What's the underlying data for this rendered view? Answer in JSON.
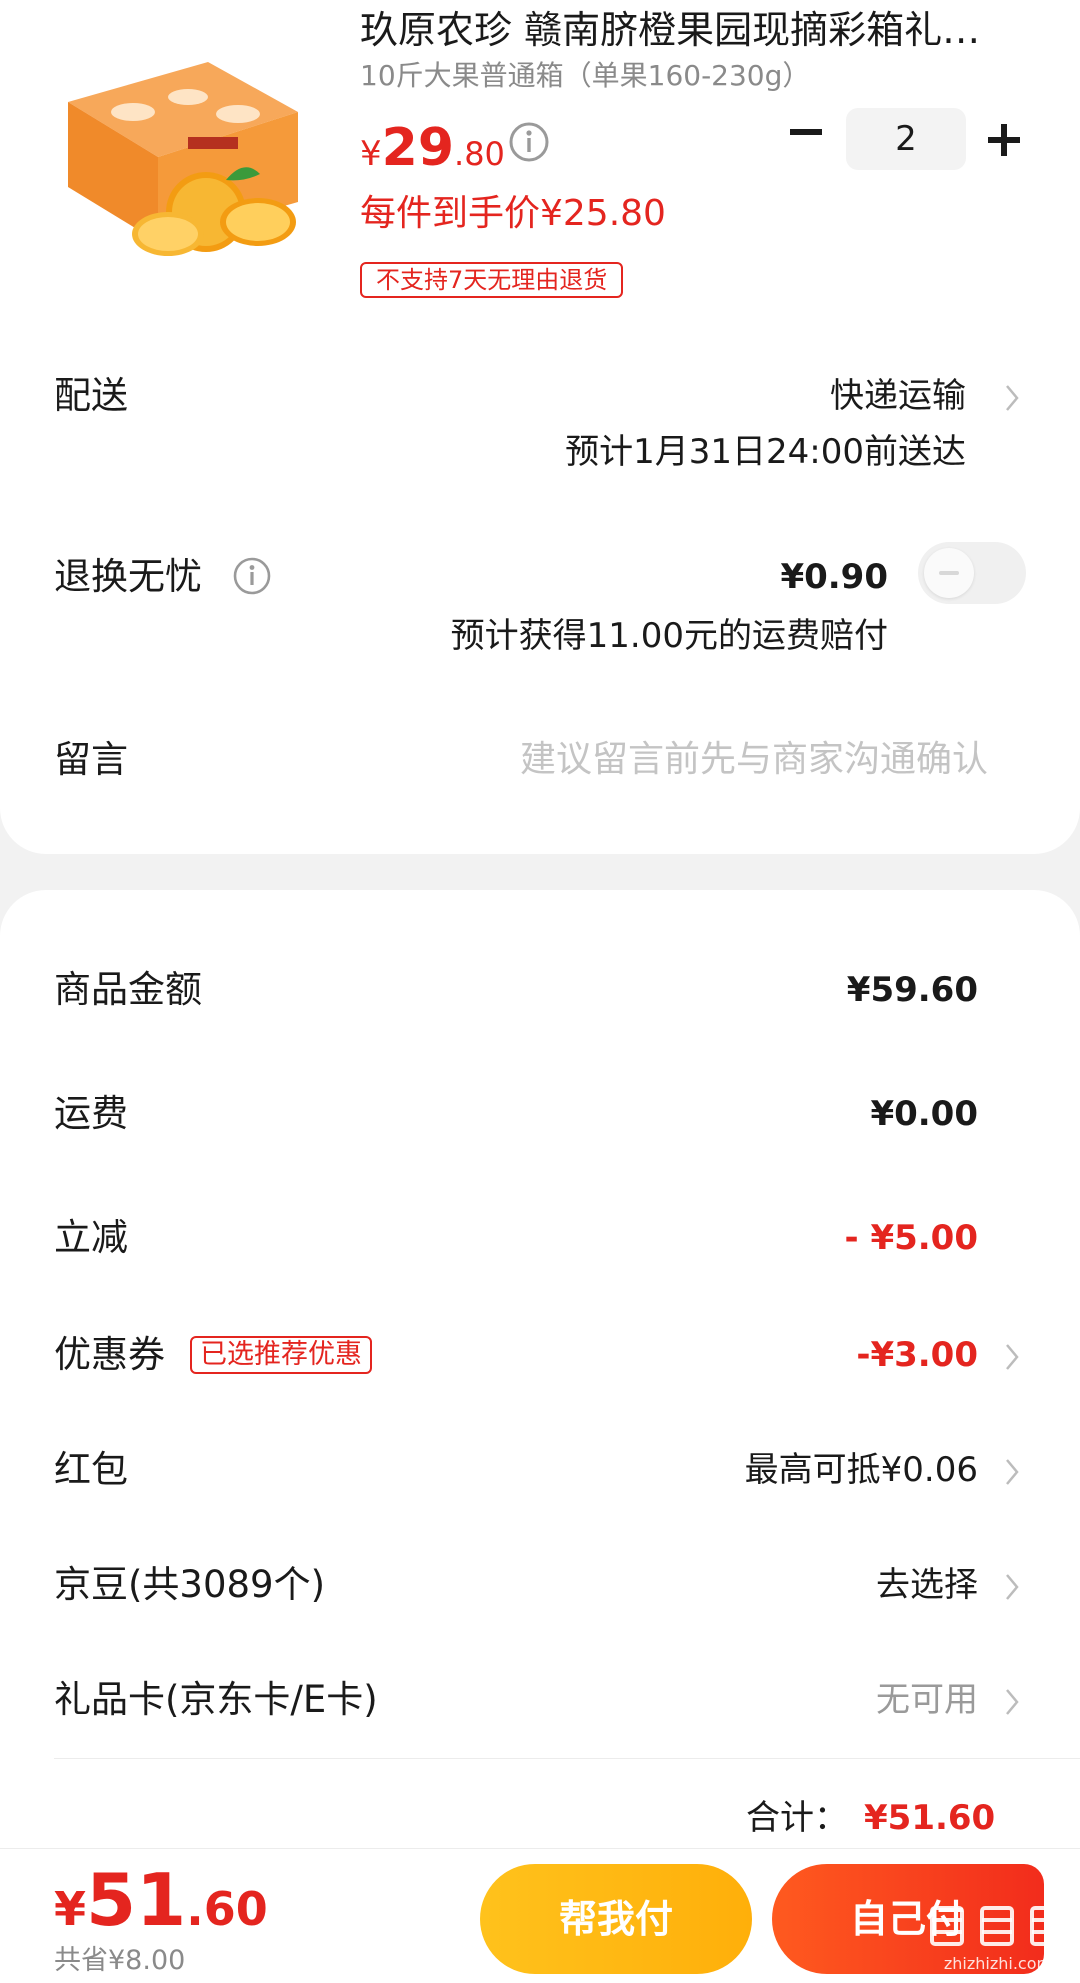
{
  "product": {
    "title": "玖原农珍 赣南脐橙果园现摘彩箱礼盒装",
    "spec": "10斤大果普通箱（单果160-230g）",
    "price_currency": "¥",
    "price_int": "29",
    "price_dec": ".80",
    "arrival_price": "每件到手价¥25.80",
    "quantity": "2",
    "return_badge": "不支持7天无理由退货"
  },
  "delivery": {
    "label": "配送",
    "method": "快递运输",
    "eta": "预计1月31日24:00前送达"
  },
  "worry_free": {
    "label": "退换无忧",
    "price": "¥0.90",
    "compensation": "预计获得11.00元的运费赔付",
    "enabled": false
  },
  "message": {
    "label": "留言",
    "placeholder": "建议留言前先与商家沟通确认"
  },
  "summary": {
    "goods_label": "商品金额",
    "goods_value": "¥59.60",
    "shipping_label": "运费",
    "shipping_value": "¥0.00",
    "discount_label": "立减",
    "discount_value": "- ¥5.00",
    "coupon_label": "优惠券",
    "coupon_tag": "已选推荐优惠",
    "coupon_value": "-¥3.00",
    "redpacket_label": "红包",
    "redpacket_value": "最高可抵¥0.06",
    "jingdou_label": "京豆(共3089个)",
    "jingdou_value": "去选择",
    "giftcard_label": "礼品卡(京东卡/E卡)",
    "giftcard_value": "无可用",
    "total_label": "合计：",
    "total_value": "¥51.60"
  },
  "bottom_bar": {
    "price_currency": "¥",
    "price_int": "51",
    "price_dec": ".60",
    "saved": "共省¥8.00",
    "help_pay_label": "帮我付",
    "self_pay_label": "自己付",
    "watermark_text": "zhizhizhi.com"
  },
  "colors": {
    "accent_red": "#e4251f",
    "help_button": "#ffb515",
    "pay_button": "#f53a1e"
  }
}
